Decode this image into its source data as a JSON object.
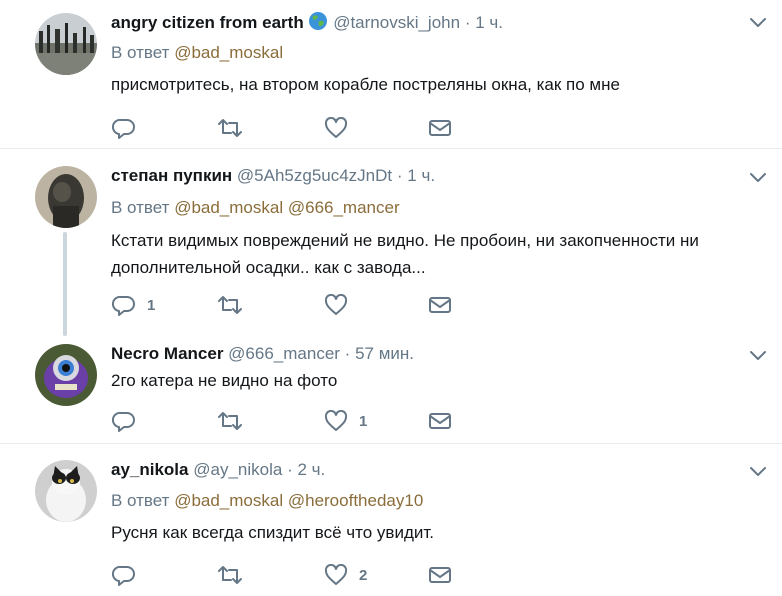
{
  "tweets": [
    {
      "name": "angry citizen from earth",
      "handle": "@tarnovski_john",
      "separator": "·",
      "time": "1 ч.",
      "reply_prefix": "В ответ",
      "reply_to": [
        "@bad_moskal"
      ],
      "text": "присмотритесь, на втором корабле постреляны окна, как по мне",
      "reply_count": "",
      "like_count": "",
      "name_emoji": "globe-emoji-icon"
    },
    {
      "name": "степан пупкин",
      "handle": "@5Ah5zg5uc4zJnDt",
      "separator": "·",
      "time": "1 ч.",
      "reply_prefix": "В ответ",
      "reply_to": [
        "@bad_moskal",
        "@666_mancer"
      ],
      "text_line1": "Кстати видимых повреждений не видно. Не пробоин, ни закопченности ни",
      "text_line2": "дополнительной осадки.. как с завода...",
      "reply_count": "1",
      "like_count": ""
    },
    {
      "name": "Necro Mancer",
      "handle": "@666_mancer",
      "separator": "·",
      "time": "57 мин.",
      "text": "2го катера не видно на фото",
      "reply_count": "",
      "like_count": "1"
    },
    {
      "name": "ay_nikola",
      "handle": "@ay_nikola",
      "separator": "·",
      "time": "2 ч.",
      "reply_prefix": "В ответ",
      "reply_to": [
        "@bad_moskal",
        "@herooftheday10"
      ],
      "text": "Русня как всегда спиздит всё что увидит.",
      "reply_count": "",
      "like_count": "2"
    }
  ],
  "icons": {
    "reply": "reply-icon",
    "retweet": "retweet-icon",
    "like": "heart-icon",
    "dm": "envelope-icon",
    "more": "chevron-down-icon"
  },
  "colors": {
    "secondary_text": "#657786",
    "mention": "#8a6d3b",
    "divider": "#e6ecf0",
    "thread_line": "#ccd6dd"
  }
}
